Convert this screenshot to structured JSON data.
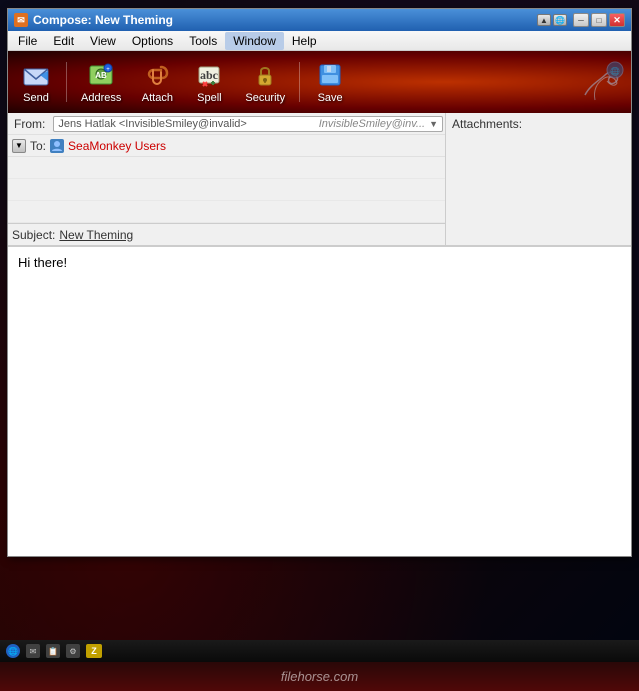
{
  "window": {
    "title": "Compose: New Theming",
    "title_icon": "✉"
  },
  "title_controls": {
    "minimize": "─",
    "restore": "□",
    "close": "✕"
  },
  "menu": {
    "items": [
      "File",
      "Edit",
      "View",
      "Options",
      "Tools",
      "Window",
      "Help"
    ]
  },
  "toolbar": {
    "buttons": [
      {
        "id": "send",
        "label": "Send",
        "icon": "send"
      },
      {
        "id": "address",
        "label": "Address",
        "icon": "address"
      },
      {
        "id": "attach",
        "label": "Attach",
        "icon": "attach"
      },
      {
        "id": "spell",
        "label": "Spell",
        "icon": "spell"
      },
      {
        "id": "security",
        "label": "Security",
        "icon": "security"
      },
      {
        "id": "save",
        "label": "Save",
        "icon": "save"
      }
    ]
  },
  "compose": {
    "from_label": "From:",
    "from_value": "Jens Hatlak <InvisibleSmiley@invalid>",
    "from_hint": "InvisibleSmiley@inv...",
    "to_label": "To:",
    "recipient": "SeaMonkey Users",
    "attachments_label": "Attachments:",
    "subject_label": "Subject:",
    "subject_value": "New Theming",
    "body": "Hi there!"
  },
  "statusbar": {
    "icons": [
      "🌐",
      "✉",
      "📋",
      "⚙",
      "Z"
    ]
  },
  "watermark": {
    "text": "filehorse.com"
  },
  "colors": {
    "accent": "#cc0000",
    "toolbar_bg": "#8b1a00",
    "recipient_color": "#cc0000"
  }
}
